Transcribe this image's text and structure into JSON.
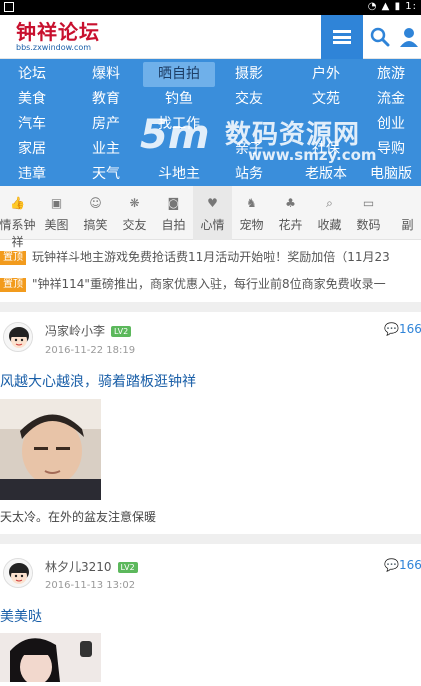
{
  "status_bar": {
    "time": "1:"
  },
  "header": {
    "logo_title": "钟祥论坛",
    "logo_url": "bbs.zxwindow.com",
    "brand_color": "#2f84d8"
  },
  "categories": [
    [
      "论坛",
      "爆料",
      "晒自拍",
      "摄影",
      "户外",
      "旅游"
    ],
    [
      "美食",
      "教育",
      "钓鱼",
      "交友",
      "文苑",
      "流金"
    ],
    [
      "汽车",
      "房产",
      "找工作",
      "",
      "",
      "创业"
    ],
    [
      "家居",
      "业主",
      "",
      "亲子",
      "社保",
      "导购"
    ],
    [
      "违章",
      "天气",
      "斗地主",
      "站务",
      "老版本",
      "电脑版"
    ]
  ],
  "active_category": "晒自拍",
  "watermark": {
    "logo": "5m",
    "title": "数码资源网",
    "url": "www.smzy.com"
  },
  "icon_tabs": [
    {
      "label": "情系钟祥",
      "icon": "thumbs-up-icon",
      "glyph": "👍"
    },
    {
      "label": "美图",
      "icon": "image-icon",
      "glyph": "▣"
    },
    {
      "label": "搞笑",
      "icon": "smile-icon",
      "glyph": "☺"
    },
    {
      "label": "交友",
      "icon": "paw-icon",
      "glyph": "❋"
    },
    {
      "label": "自拍",
      "icon": "camera-icon",
      "glyph": "◙"
    },
    {
      "label": "心情",
      "icon": "heart-icon",
      "glyph": "♥"
    },
    {
      "label": "宠物",
      "icon": "dog-icon",
      "glyph": "♞"
    },
    {
      "label": "花卉",
      "icon": "tree-icon",
      "glyph": "♣"
    },
    {
      "label": "收藏",
      "icon": "search-icon",
      "glyph": "⌕"
    },
    {
      "label": "数码",
      "icon": "monitor-icon",
      "glyph": "▭"
    },
    {
      "label": "副",
      "icon": "partial-icon",
      "glyph": ""
    }
  ],
  "active_icon_tab": "心情",
  "notices": [
    {
      "tag": "置顶",
      "text": "玩钟祥斗地主游戏免费抢话费11月活动开始啦！奖励加倍（11月23"
    },
    {
      "tag": "置顶",
      "text": "\"钟祥114\"重磅推出，商家优惠入驻，每行业前8位商家免费收录一"
    }
  ],
  "posts": [
    {
      "author": "冯家岭小李",
      "level": "LV2",
      "date": "2016-11-22 18:19",
      "comments": "166",
      "title": "风越大心越浪，骑着踏板逛钟祥",
      "text": "天太冷。在外的盆友注意保暖"
    },
    {
      "author": "林夕儿3210",
      "level": "LV2",
      "date": "2016-11-13 13:02",
      "comments": "166",
      "title": "美美哒",
      "text": ""
    }
  ]
}
